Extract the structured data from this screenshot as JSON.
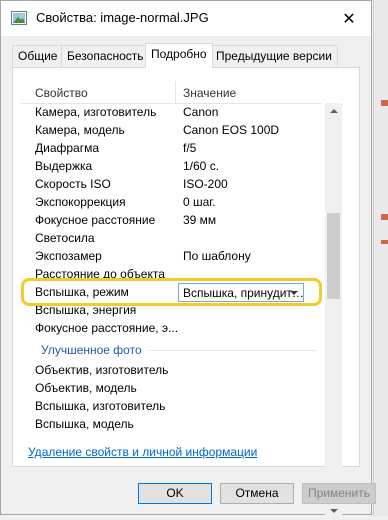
{
  "window": {
    "title": "Свойства: image-normal.JPG",
    "close_glyph": "✕"
  },
  "tabs": [
    {
      "label": "Общие"
    },
    {
      "label": "Безопасность"
    },
    {
      "label": "Подробно",
      "active": true
    },
    {
      "label": "Предыдущие версии"
    }
  ],
  "list": {
    "header": {
      "name": "Свойство",
      "value": "Значение"
    },
    "rows": [
      {
        "name": "Камера, изготовитель",
        "value": "Canon"
      },
      {
        "name": "Камера, модель",
        "value": "Canon EOS 100D"
      },
      {
        "name": "Диафрагма",
        "value": "f/5"
      },
      {
        "name": "Выдержка",
        "value": "1/60 с."
      },
      {
        "name": "Скорость ISO",
        "value": "ISO-200"
      },
      {
        "name": "Экспокоррекция",
        "value": "0 шаг."
      },
      {
        "name": "Фокусное расстояние",
        "value": "39 мм"
      },
      {
        "name": "Светосила",
        "value": ""
      },
      {
        "name": "Экспозамер",
        "value": "По шаблону"
      },
      {
        "name": "Расстояние до объекта",
        "value": ""
      },
      {
        "name": "Вспышка, режим",
        "value": "Вспышка, принудит…",
        "editable": true
      },
      {
        "name": "Вспышка, энергия",
        "value": ""
      },
      {
        "name": "Фокусное расстояние, э...",
        "value": ""
      }
    ],
    "group_label": "Улучшенное фото",
    "group_rows": [
      {
        "name": "Объектив, изготовитель"
      },
      {
        "name": "Объектив, модель"
      },
      {
        "name": "Вспышка, изготовитель"
      },
      {
        "name": "Вспышка, модель"
      }
    ]
  },
  "remove_link": "Удаление свойств и личной информации",
  "buttons": {
    "ok": "OK",
    "cancel": "Отмена",
    "apply": "Применить"
  },
  "colors": {
    "highlight": "#f2cc2b",
    "group_label": "#1e5ca8",
    "link": "#0066cc"
  }
}
